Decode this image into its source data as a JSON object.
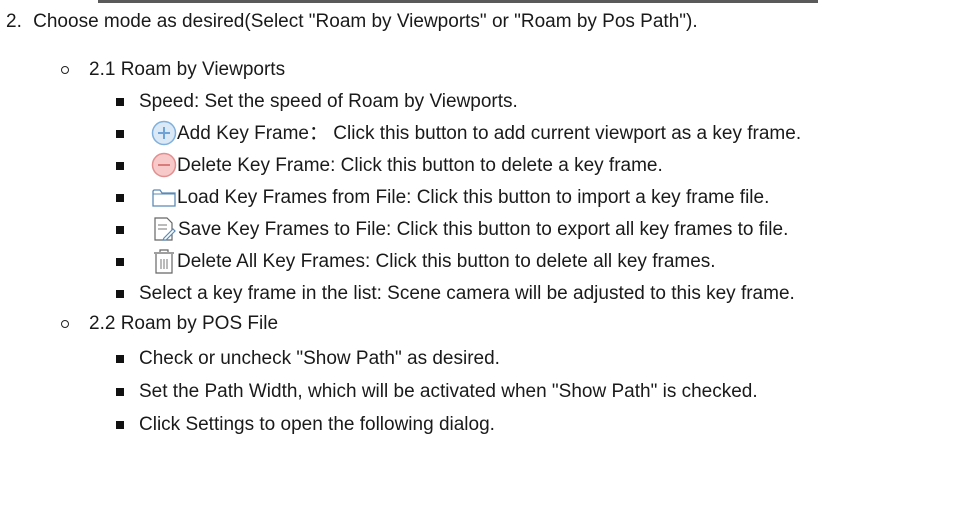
{
  "step": {
    "number": "2.",
    "text": "Choose mode as desired(Select \"Roam by Viewports\" or \"Roam by Pos Path\")."
  },
  "sections": [
    {
      "title": "2.1 Roam by Viewports",
      "items": [
        {
          "icon": "",
          "text": "Speed: Set the speed of Roam by Viewports."
        },
        {
          "icon": "add-key-frame-icon",
          "text": "Add Key Frame： Click this button to add current viewport as a key frame."
        },
        {
          "icon": "delete-key-frame-icon",
          "text": "Delete Key Frame: Click this button to delete a key frame."
        },
        {
          "icon": "folder-icon",
          "text": "Load Key Frames from File: Click this button to import a key frame file."
        },
        {
          "icon": "save-file-icon",
          "text": "Save Key Frames to File: Click this button to export all key frames to file."
        },
        {
          "icon": "trash-icon",
          "text": "Delete All Key Frames: Click this button to delete all key frames."
        },
        {
          "icon": "",
          "text": "Select a key frame in the list: Scene camera will be adjusted to this key frame."
        }
      ]
    },
    {
      "title": "2.2 Roam by POS File",
      "items": [
        {
          "icon": "",
          "text": "Check or uncheck \"Show Path\" as desired."
        },
        {
          "icon": "",
          "text": "Set the Path Width, which will be activated when \"Show Path\" is checked."
        },
        {
          "icon": "",
          "text": "Click Settings to open the following dialog."
        }
      ]
    }
  ],
  "colors": {
    "add_icon_fill": "#dbe9f7",
    "add_icon_stroke": "#7fb0dd",
    "delete_icon_fill": "#f8c9c9",
    "delete_icon_stroke": "#e38f8f",
    "outline_icon_stroke": "#5b8bb5"
  }
}
